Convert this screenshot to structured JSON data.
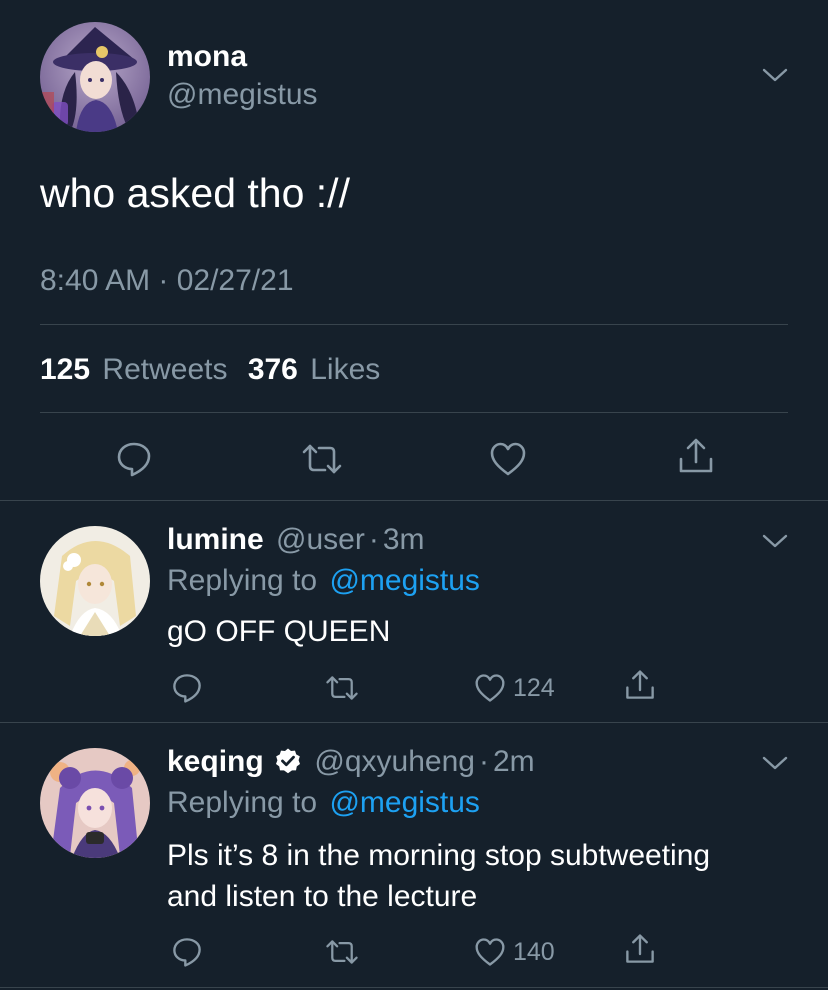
{
  "main_tweet": {
    "display_name": "mona",
    "handle": "@megistus",
    "text": "who asked tho ://",
    "timestamp": "8:40 AM · 02/27/21",
    "retweet_count": "125",
    "retweets_label": "Retweets",
    "like_count": "376",
    "likes_label": "Likes"
  },
  "replies": [
    {
      "display_name": "lumine",
      "handle": "@user",
      "sep": "·",
      "time": "3m",
      "replying_prefix": "Replying to",
      "replying_to": "@megistus",
      "text": "gO OFF QUEEN",
      "like_count": "124",
      "verified": false
    },
    {
      "display_name": "keqing",
      "handle": "@qxyuheng",
      "sep": "·",
      "time": "2m",
      "replying_prefix": "Replying to",
      "replying_to": "@megistus",
      "text_line1": "Pls it’s 8 in the morning stop subtweeting",
      "text_line2": "and listen to the lecture",
      "like_count": "140",
      "verified": true
    }
  ],
  "colors": {
    "background": "#15202b",
    "muted": "#8899a6",
    "link": "#1da1f2",
    "divider": "#38444d"
  },
  "icons": [
    "reply-icon",
    "retweet-icon",
    "like-icon",
    "share-icon",
    "chevron-down-icon",
    "verified-badge-icon"
  ]
}
